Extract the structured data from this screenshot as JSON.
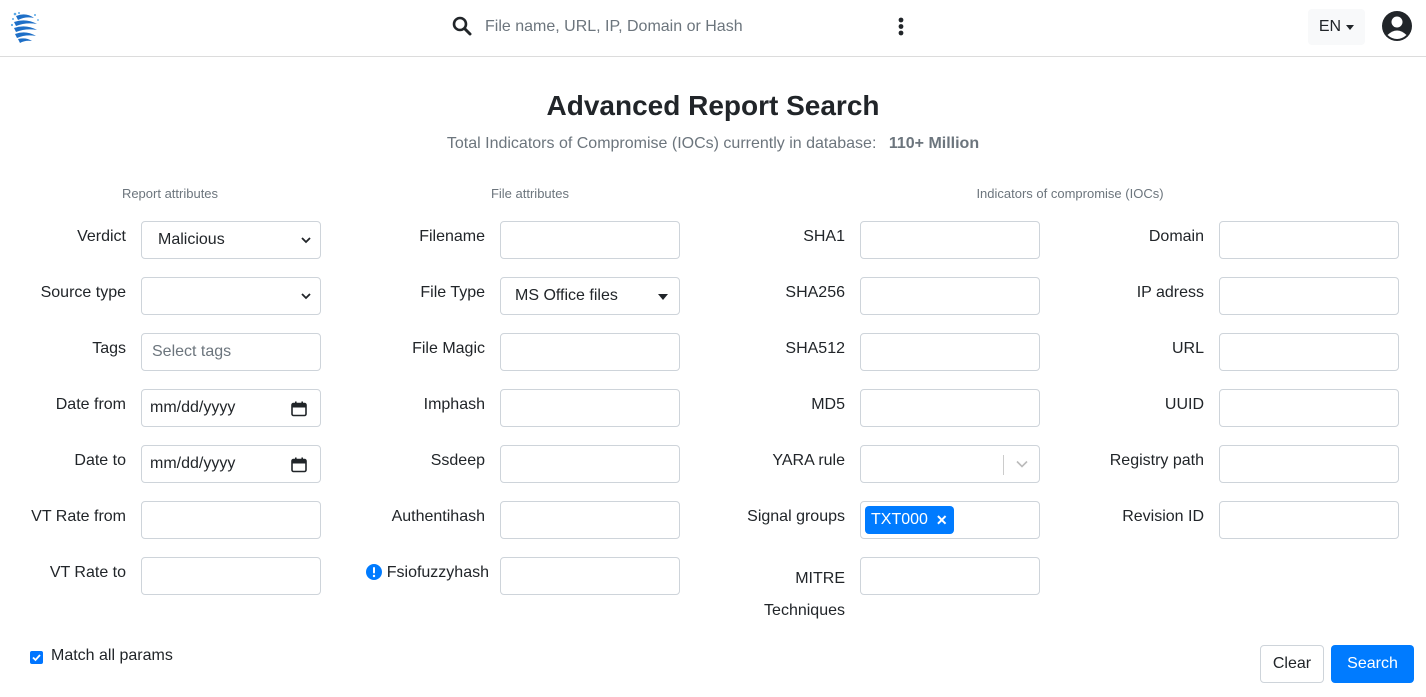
{
  "header": {
    "search_placeholder": "File name, URL, IP, Domain or Hash",
    "lang": "EN"
  },
  "page": {
    "title": "Advanced Report Search",
    "subtitle": "Total Indicators of Compromise (IOCs) currently in database:",
    "ioc_count": "110+ Million"
  },
  "sections": {
    "report": "Report attributes",
    "file": "File attributes",
    "iocs": "Indicators of compromise (IOCs)"
  },
  "report": {
    "verdict_label": "Verdict",
    "verdict_value": "Malicious",
    "source_type_label": "Source type",
    "source_type_value": "",
    "tags_label": "Tags",
    "tags_placeholder": "Select tags",
    "date_from_label": "Date from",
    "date_from_value": "mm/dd/yyyy",
    "date_to_label": "Date to",
    "date_to_value": "mm/dd/yyyy",
    "vt_from_label": "VT Rate from",
    "vt_to_label": "VT Rate to"
  },
  "file": {
    "filename_label": "Filename",
    "file_type_label": "File Type",
    "file_type_value": "MS Office files",
    "file_magic_label": "File Magic",
    "imphash_label": "Imphash",
    "ssdeep_label": "Ssdeep",
    "authentihash_label": "Authentihash",
    "fsiofuzzyhash_label": "Fsiofuzzyhash"
  },
  "iocs": {
    "sha1_label": "SHA1",
    "sha256_label": "SHA256",
    "sha512_label": "SHA512",
    "md5_label": "MD5",
    "yara_label": "YARA rule",
    "signal_groups_label": "Signal groups",
    "signal_groups_tag": "TXT000",
    "mitre_label_1": "MITRE",
    "mitre_label_2": "Techniques",
    "domain_label": "Domain",
    "ip_label": "IP adress",
    "url_label": "URL",
    "uuid_label": "UUID",
    "registry_label": "Registry path",
    "revision_label": "Revision ID"
  },
  "footer": {
    "match_all_label": "Match all params",
    "clear_label": "Clear",
    "search_label": "Search"
  },
  "colors": {
    "primary": "#007bff",
    "muted": "#6c757d"
  }
}
